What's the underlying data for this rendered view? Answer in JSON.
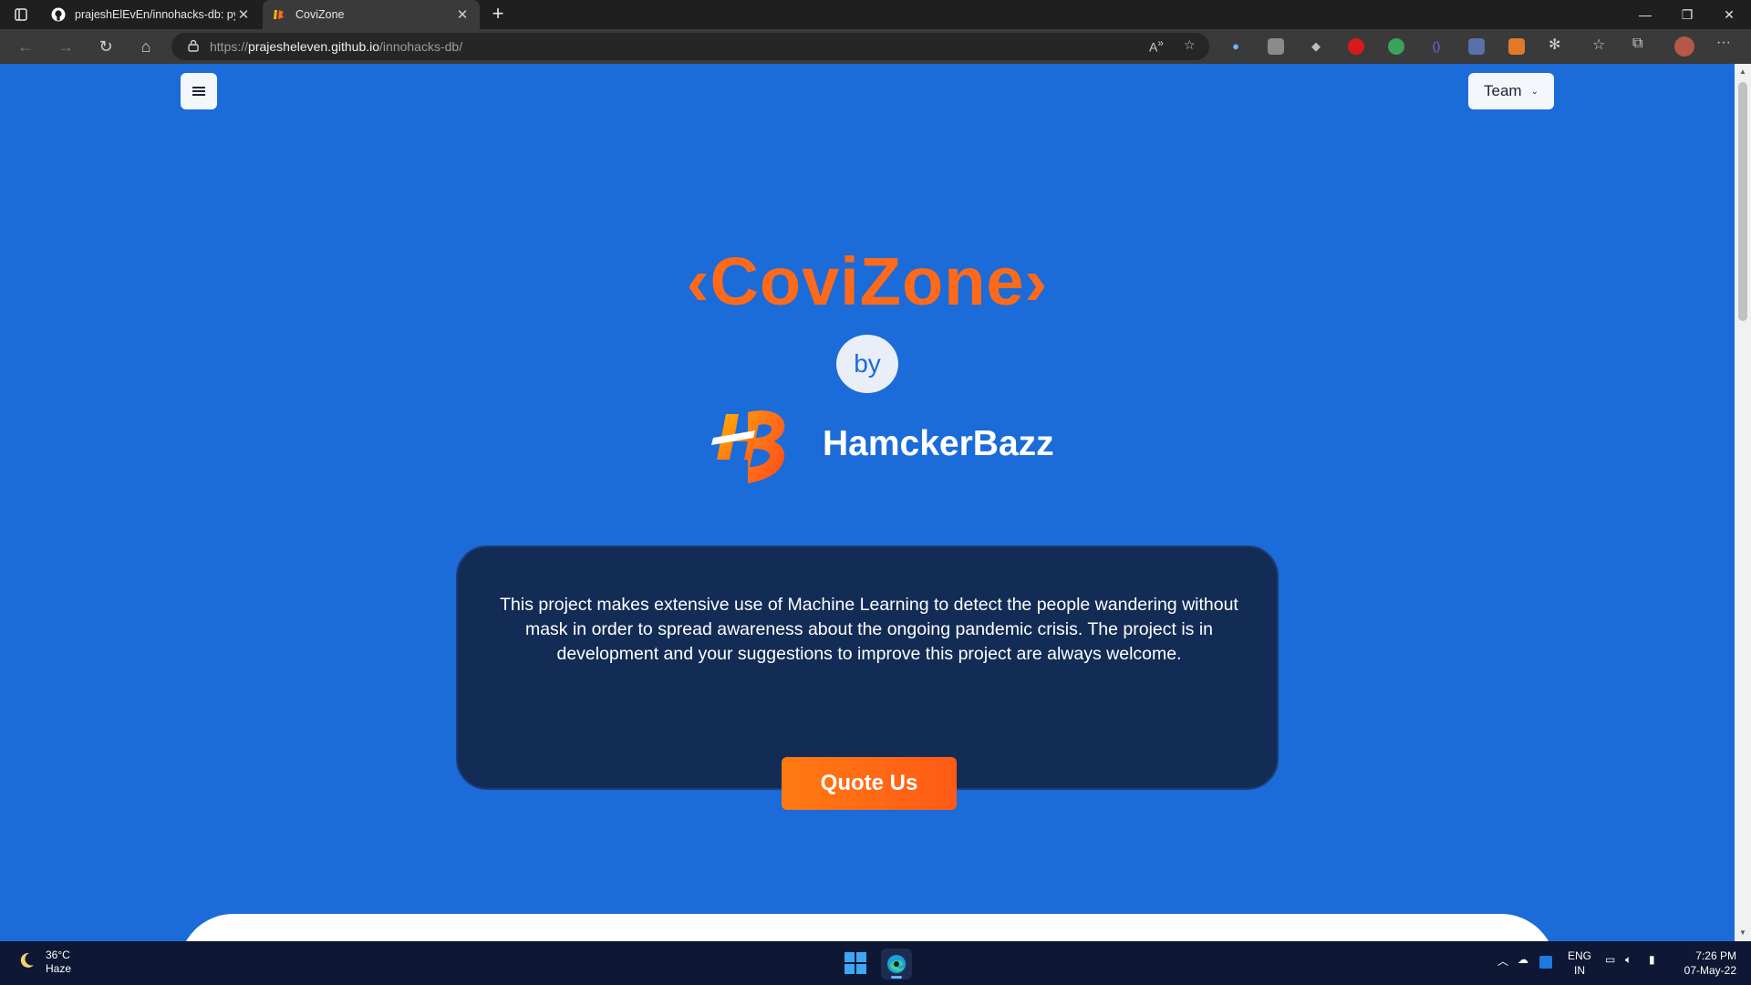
{
  "browser": {
    "tabs": [
      {
        "title": "prajeshElEvEn/innohacks-db: pyt",
        "icon": "github-icon",
        "active": false
      },
      {
        "title": "CoviZone",
        "icon": "hb-favicon",
        "active": true
      }
    ],
    "new_tab_label": "+",
    "address": {
      "scheme": "https://",
      "host": "prajesheleven.github.io",
      "path": "/innohacks-db/"
    },
    "window_controls": [
      "minimize",
      "restore",
      "close"
    ]
  },
  "page": {
    "nav": {
      "menu_icon": "hamburger-icon",
      "team_label": "Team"
    },
    "hero": {
      "title": "‹CoviZone›",
      "by_label": "by",
      "org_name": "HamckerBazz"
    },
    "card": {
      "description": "This project makes extensive use of Machine Learning to detect the people wandering without mask in order to spread awareness about the ongoing pandemic crisis. The project is in development and your suggestions to improve this project are always welcome.",
      "button_label": "Quote Us"
    },
    "colors": {
      "background": "#1b6bd9",
      "accent": "#ff6a1a",
      "card": "#132c55"
    }
  },
  "taskbar": {
    "weather": {
      "temp": "36°C",
      "condition": "Haze"
    },
    "language": {
      "line1": "ENG",
      "line2": "IN"
    },
    "clock": {
      "time": "7:26 PM",
      "date": "07-May-22"
    }
  }
}
